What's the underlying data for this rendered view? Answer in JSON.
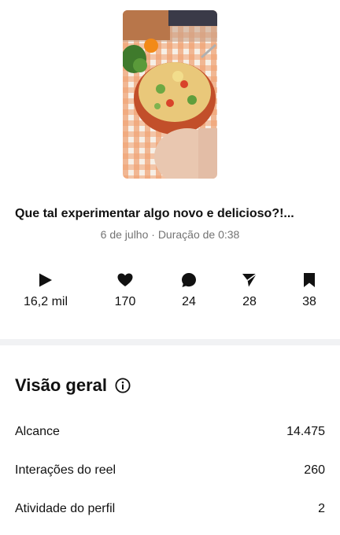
{
  "post": {
    "caption": "Que tal experimentar algo novo e delicioso?!...",
    "meta": "6 de julho · Duração de 0:38"
  },
  "stats": [
    {
      "icon": "play-icon",
      "value": "16,2 mil"
    },
    {
      "icon": "heart-icon",
      "value": "170"
    },
    {
      "icon": "comment-icon",
      "value": "24"
    },
    {
      "icon": "send-icon",
      "value": "28"
    },
    {
      "icon": "bookmark-icon",
      "value": "38"
    }
  ],
  "overview": {
    "title": "Visão geral",
    "rows": [
      {
        "label": "Alcance",
        "value": "14.475"
      },
      {
        "label": "Interações do reel",
        "value": "260"
      },
      {
        "label": "Atividade do perfil",
        "value": "2"
      }
    ]
  },
  "colors": {
    "text": "#111111",
    "muted": "#737373",
    "divider": "#f1f2f4"
  }
}
